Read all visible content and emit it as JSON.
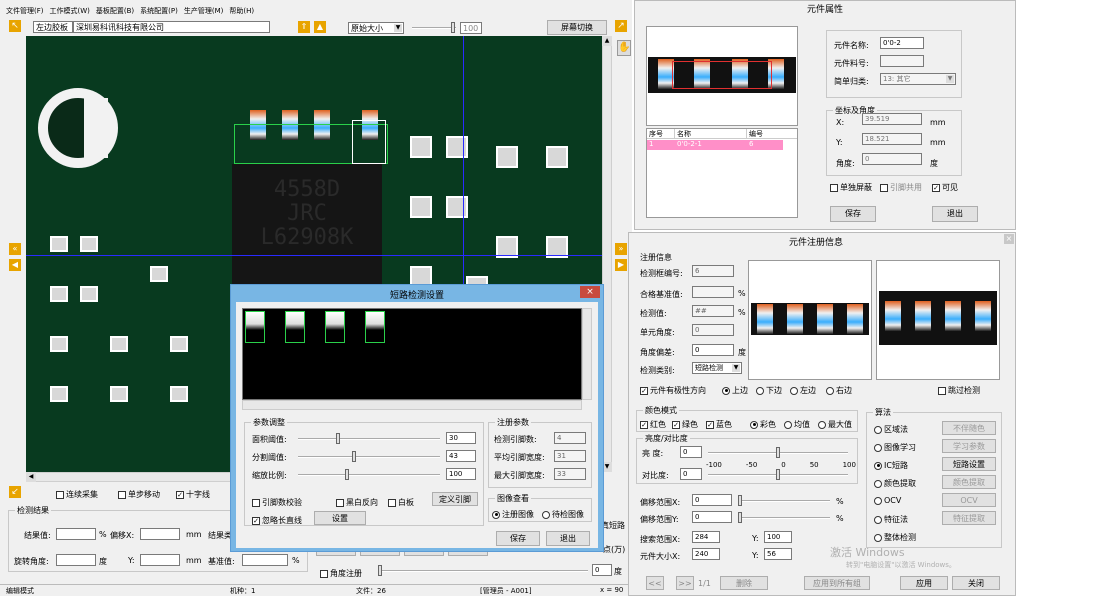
{
  "menu": [
    "文件管理(F)",
    "工作模式(W)",
    "基板配置(B)",
    "系统配置(P)",
    "生产管理(M)",
    "帮助(H)"
  ],
  "toolbar": {
    "board_side": "左边胶板",
    "company": "深圳易科讯科技有限公司",
    "zoom_select": "原始大小",
    "zoom_value": "100",
    "screen_switch": "屏幕切换"
  },
  "pcb": {
    "chip_text": [
      "4558D",
      "JRC",
      "L62908K"
    ]
  },
  "bottom_left": {
    "checks": [
      {
        "label": "连续采集",
        "checked": false
      },
      {
        "label": "单步移动",
        "checked": false
      },
      {
        "label": "十字线",
        "checked": true
      }
    ],
    "result_title": "检测结果",
    "result_value_label": "结果值:",
    "pct": "%",
    "offset_x": "偏移X:",
    "mm": "mm",
    "result_label": "结果类",
    "rotate_label": "旋转角度:",
    "degree": "度",
    "y_label": "Y:",
    "baseline_label": "基准值:",
    "angle_reg": "角度注册",
    "angle_value": "0",
    "degree2": "度",
    "short_label": "真短路",
    "minutes": "点(万)"
  },
  "statusbar": {
    "mode": "编辑模式",
    "machine": "机种：1",
    "file": "文件：26",
    "user": "[管理员 - A001]",
    "coord": "x = 90"
  },
  "props": {
    "title": "元件属性",
    "name_label": "元件名称:",
    "name_value": "0'0-2",
    "material_label": "元件料号:",
    "material_value": "",
    "class_label": "简单归类:",
    "class_value": "13: 其它",
    "table_headers": [
      "序号",
      "名称",
      "编号"
    ],
    "table_row": [
      "1",
      "0'0-2-1",
      "6"
    ],
    "coord_title": "坐标及角度",
    "x_label": "X:",
    "x_value": "39.519",
    "y_label": "Y:",
    "y_value": "18.521",
    "mm": "mm",
    "angle_label": "角度:",
    "angle_value": "0",
    "degree": "度",
    "checks": [
      {
        "label": "单独屏蔽",
        "checked": false
      },
      {
        "label": "引脚共用",
        "checked": false
      },
      {
        "label": "可见",
        "checked": true
      }
    ],
    "save": "保存",
    "exit": "退出"
  },
  "reg": {
    "title": "元件注册信息",
    "info_title": "注册信息",
    "box_no_label": "检测框编号:",
    "box_no": "6",
    "pass_label": "合格基准值:",
    "pass_value": "",
    "pct": "%",
    "detect_label": "检测值:",
    "detect_value": "##",
    "unit_angle_label": "单元角度:",
    "unit_angle": "0",
    "angle_off_label": "角度偏差:",
    "angle_off": "0",
    "degree": "度",
    "type_label": "检测类别:",
    "type_value": "短路检测",
    "polarity_label": "元件有极性方向",
    "dirs": [
      {
        "label": "上边",
        "on": true
      },
      {
        "label": "下边",
        "on": false
      },
      {
        "label": "左边",
        "on": false
      },
      {
        "label": "右边",
        "on": false
      }
    ],
    "skip_label": "跳过检测",
    "color_title": "颜色模式",
    "colors": [
      {
        "label": "红色",
        "checked": true
      },
      {
        "label": "绿色",
        "checked": true
      },
      {
        "label": "蓝色",
        "checked": true
      }
    ],
    "color_modes": [
      {
        "label": "彩色",
        "on": true
      },
      {
        "label": "均值",
        "on": false
      },
      {
        "label": "最大值",
        "on": false
      }
    ],
    "bright_title": "亮度/对比度",
    "bright_label": "亮  度:",
    "bright_value": "0",
    "contrast_label": "对比度:",
    "contrast_value": "0",
    "scale": [
      "-100",
      "-50",
      "0",
      "50",
      "100"
    ],
    "offx_label": "偏移范围X:",
    "offx": "0",
    "offy_label": "偏移范围Y:",
    "offy": "0",
    "pct2": "%",
    "search_label": "搜索范围X:",
    "search_x": "284",
    "search_y_label": "Y:",
    "search_y": "100",
    "size_label": "元件大小X:",
    "size_x": "240",
    "size_y_label": "Y:",
    "size_y": "56",
    "algo_title": "算法",
    "algos": [
      {
        "label": "区域法",
        "on": false,
        "btn": "不伴随色"
      },
      {
        "label": "图像学习",
        "on": false,
        "btn": "学习参数"
      },
      {
        "label": "IC短路",
        "on": true,
        "btn": "短路设置"
      },
      {
        "label": "颜色提取",
        "on": false,
        "btn": "颜色提取"
      },
      {
        "label": "OCV",
        "on": false,
        "btn": "OCV"
      },
      {
        "label": "特征法",
        "on": false,
        "btn": "特征提取"
      },
      {
        "label": "整体检测",
        "on": false,
        "btn": ""
      }
    ],
    "nav": [
      "<<",
      ">>",
      "1/1",
      "删除",
      "应用到所有组",
      "应用",
      "关闭"
    ],
    "watermark1": "激活 Windows",
    "watermark2": "转到\"电脑设置\"以激活 Windows。"
  },
  "short": {
    "title": "短路检测设置",
    "param_title": "参数调整",
    "params": [
      {
        "label": "面积阈值:",
        "value": "30"
      },
      {
        "label": "分割阈值:",
        "value": "43"
      },
      {
        "label": "缩放比例:",
        "value": "100"
      }
    ],
    "reg_title": "注册参数",
    "reg_params": [
      {
        "label": "检测引脚数:",
        "value": "4"
      },
      {
        "label": "平均引脚宽度:",
        "value": "31"
      },
      {
        "label": "最大引脚宽度:",
        "value": "33"
      }
    ],
    "checks": [
      {
        "label": "引脚数校验",
        "checked": false
      },
      {
        "label": "黑白反向",
        "checked": false
      },
      {
        "label": "白板",
        "checked": false
      }
    ],
    "define_pin": "定义引脚",
    "ignore_label": "忽略长直线",
    "ignore_checked": true,
    "set": "设置",
    "view_title": "图像查看",
    "view_modes": [
      {
        "label": "注册图像",
        "on": true
      },
      {
        "label": "待检图像",
        "on": false
      }
    ],
    "save": "保存",
    "exit": "退出"
  }
}
